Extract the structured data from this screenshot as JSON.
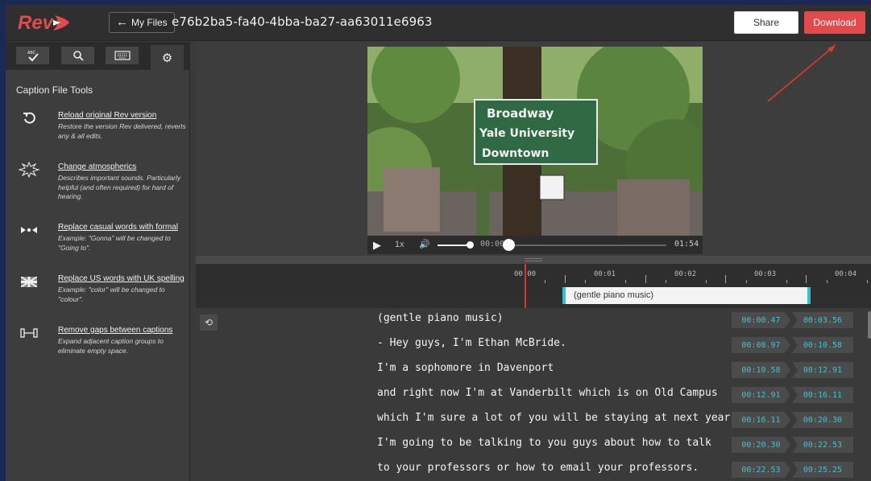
{
  "header": {
    "logo_text": "Rev",
    "my_files_label": "My Files",
    "filename": "e76b2ba5-fa40-4bba-ba27-aa63011e6963",
    "share_label": "Share",
    "download_label": "Download"
  },
  "colors": {
    "brand_red": "#e24b4b",
    "accent_cyan": "#37c6d0",
    "playhead_red": "#dd3333"
  },
  "sidebar": {
    "tool_tabs": [
      {
        "icon": "spellcheck-icon",
        "glyph": "ABC✓"
      },
      {
        "icon": "search-icon",
        "glyph": "🔍"
      },
      {
        "icon": "keyboard-icon",
        "glyph": "⌨"
      },
      {
        "icon": "gear-icon",
        "glyph": "⚙"
      }
    ],
    "title": "Caption File Tools",
    "tools": [
      {
        "icon": "reload-icon",
        "name": "Reload original Rev version",
        "desc": "Restore the version Rev delivered, reverts any & all edits."
      },
      {
        "icon": "atmospherics-icon",
        "name": "Change atmospherics",
        "desc": "Describes important sounds. Particularly helpful (and often required) for hard of hearing."
      },
      {
        "icon": "formal-words-icon",
        "name": "Replace casual words with formal",
        "desc": "Example: \"Gonna\" will be changed to \"Going to\"."
      },
      {
        "icon": "uk-flag-icon",
        "name": "Replace US words with UK spelling",
        "desc": "Example: \"color\" will be changed to \"colour\"."
      },
      {
        "icon": "gap-icon",
        "name": "Remove gaps between captions",
        "desc": "Expand adjacent caption groups to eliminate empty space."
      }
    ]
  },
  "player": {
    "speed": "1x",
    "current_time": "00:00",
    "duration": "01:54",
    "volume_level": 1.0,
    "progress": 0.0,
    "sign_lines": [
      "Broadway",
      "Yale University",
      "Downtown"
    ]
  },
  "timeline": {
    "ticks": [
      "00:00",
      "00:01",
      "00:02",
      "00:03",
      "00:04"
    ],
    "caption_block": "(gentle piano music)"
  },
  "captions": [
    {
      "text": "(gentle piano music)",
      "start": "00:00.47",
      "end": "00:03.56"
    },
    {
      "text": "- Hey guys, I'm Ethan McBride.",
      "start": "00:08.97",
      "end": "00:10.58"
    },
    {
      "text": "I'm a sophomore in Davenport",
      "start": "00:10.58",
      "end": "00:12.91"
    },
    {
      "text": "and right now I'm at Vanderbilt which is on Old Campus",
      "start": "00:12.91",
      "end": "00:16.11"
    },
    {
      "text": "which I'm sure a lot of you will be staying at next year.",
      "start": "00:16.11",
      "end": "00:20.30"
    },
    {
      "text": "I'm going to be talking to you guys about how to talk",
      "start": "00:20.30",
      "end": "00:22.53"
    },
    {
      "text": "to your professors or how to email your professors.",
      "start": "00:22.53",
      "end": "00:25.25"
    }
  ]
}
